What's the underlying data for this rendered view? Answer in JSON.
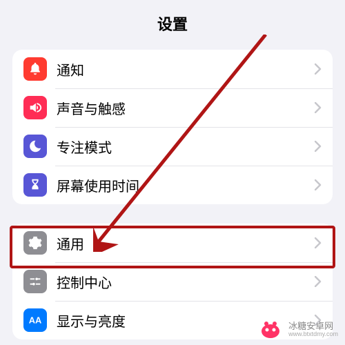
{
  "header": {
    "title": "设置"
  },
  "group1": {
    "items": [
      {
        "label": "通知",
        "icon": "bell"
      },
      {
        "label": "声音与触感",
        "icon": "speaker"
      },
      {
        "label": "专注模式",
        "icon": "moon"
      },
      {
        "label": "屏幕使用时间",
        "icon": "hourglass"
      }
    ]
  },
  "group2": {
    "items": [
      {
        "label": "通用",
        "icon": "gear"
      },
      {
        "label": "控制中心",
        "icon": "sliders"
      },
      {
        "label": "显示与亮度",
        "icon": "aa"
      }
    ]
  },
  "watermark": {
    "brand": "冰糖安卓网",
    "url": "www.btxtdmy.com"
  },
  "annotation": {
    "highlight_target": "通用",
    "arrow_color": "#b01515"
  }
}
